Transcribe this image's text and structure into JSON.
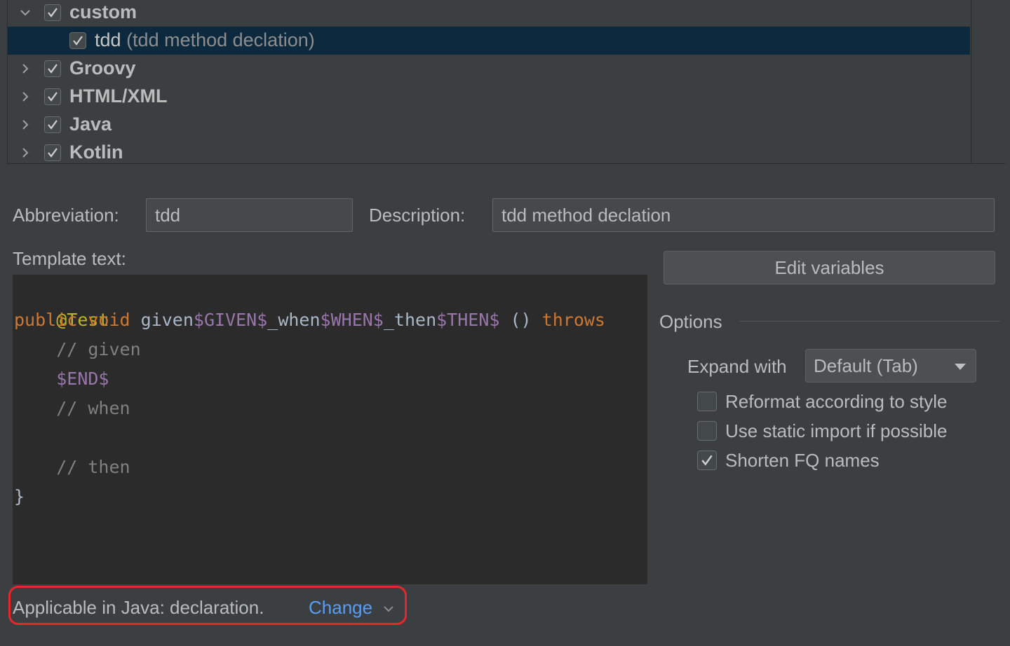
{
  "tree": {
    "items": [
      {
        "label": "custom",
        "expanded": true,
        "checked": true,
        "level": 0
      },
      {
        "label": "tdd",
        "description": "(tdd method declation)",
        "checked": true,
        "level": 1,
        "selected": true
      },
      {
        "label": "Groovy",
        "expanded": false,
        "checked": true,
        "level": 0
      },
      {
        "label": "HTML/XML",
        "expanded": false,
        "checked": true,
        "level": 0
      },
      {
        "label": "Java",
        "expanded": false,
        "checked": true,
        "level": 0
      },
      {
        "label": "Kotlin",
        "expanded": false,
        "checked": true,
        "level": 0
      }
    ]
  },
  "form": {
    "abbreviation_label": "Abbreviation:",
    "abbreviation_value": "tdd",
    "description_label": "Description:",
    "description_value": "tdd method declation",
    "template_text_label": "Template text:"
  },
  "editor": {
    "lines": [
      "@Test",
      "public void given$GIVEN$_when$WHEN$_then$THEN$ () throws",
      "    // given",
      "    $END$",
      "    // when",
      "",
      "    // then",
      "}"
    ],
    "tokens": {
      "l1_ann": "@Test",
      "l2_public": "public",
      "l2_void": "void",
      "l2_given": "given",
      "l2_var_given": "$GIVEN$",
      "l2_when": "_when",
      "l2_var_when": "$WHEN$",
      "l2_then": "_then",
      "l2_var_then": "$THEN$",
      "l2_parens": "()",
      "l2_throws": "throws",
      "l3": "// given",
      "l4": "$END$",
      "l5": "// when",
      "l7": "// then",
      "l8": "}"
    }
  },
  "right": {
    "edit_variables_label": "Edit variables",
    "options_title": "Options",
    "expand_with_label": "Expand with",
    "expand_with_value": "Default (Tab)",
    "options": [
      {
        "label": "Reformat according to style",
        "checked": false
      },
      {
        "label": "Use static import if possible",
        "checked": false
      },
      {
        "label": "Shorten FQ names",
        "checked": true
      }
    ]
  },
  "footer": {
    "applicable_text": "Applicable in Java: declaration.",
    "change_label": "Change"
  },
  "colors": {
    "background": "#3c3f41",
    "editor_background": "#2b2b2b",
    "selection": "#0d293e",
    "keyword": "#cc7832",
    "template_variable": "#9876aa",
    "comment": "#808080",
    "annotation": "#bbb529",
    "link": "#589df6",
    "highlight_border": "#e8272c"
  },
  "icons": {
    "expanded": "chevron-down-icon",
    "collapsed": "chevron-right-icon",
    "checked": "checkmark-icon",
    "dropdown": "dropdown-arrow-icon"
  }
}
